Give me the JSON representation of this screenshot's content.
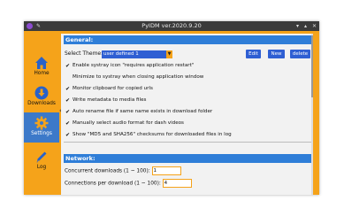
{
  "window": {
    "title": "PyIDM ver.2020.9.20"
  },
  "sidebar": {
    "items": [
      {
        "label": "Home",
        "icon": "home-icon"
      },
      {
        "label": "Downloads",
        "icon": "download-icon"
      },
      {
        "label": "Settings",
        "icon": "gear-icon",
        "active": true
      },
      {
        "label": "Log",
        "icon": "pencil-icon"
      }
    ]
  },
  "general": {
    "header": "General:",
    "theme_label": "Select Theme:",
    "theme_value": "user defined 1",
    "buttons": {
      "edit": "Edit",
      "new": "New",
      "delete": "delete"
    },
    "checkboxes": [
      {
        "label": "Enable systray icon \"requires application restart\"",
        "checked": true
      },
      {
        "label": "Minimize to systray when closing application window",
        "checked": false
      },
      {
        "label": "Monitor clipboard for copied urls",
        "checked": true
      },
      {
        "label": "Write metadata to media files",
        "checked": true
      },
      {
        "label": "Auto rename file if same name exists in download folder",
        "checked": true
      },
      {
        "label": "Manually select audio format for dash videos",
        "checked": true
      },
      {
        "label": "Show \"MD5 and SHA256\" checksums for downloaded files in log",
        "checked": true
      }
    ]
  },
  "network": {
    "header": "Network:",
    "concurrent_label": "Concurrent downloads (1 ~ 100):",
    "concurrent_value": "1",
    "connections_label": "Connections per download (1 ~ 100):",
    "connections_value": "4"
  },
  "colors": {
    "accent": "#F5A31A",
    "primary": "#2f7ed8",
    "button": "#2f5fd3"
  }
}
